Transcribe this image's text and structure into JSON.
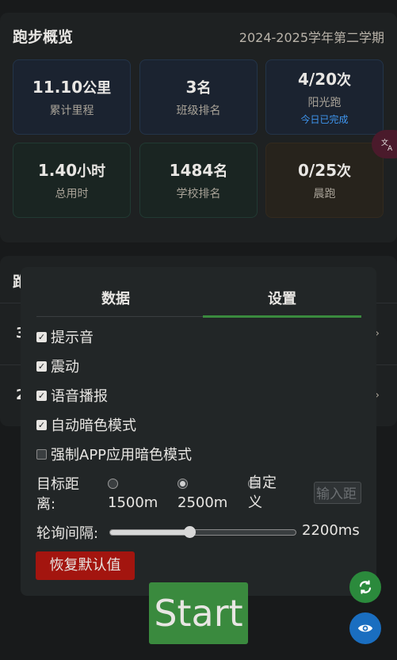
{
  "overview": {
    "title": "跑步概览",
    "term": "2024-2025学年第二学期",
    "stats": [
      {
        "value": "11.10",
        "unit": "公里",
        "label": "累计里程"
      },
      {
        "value": "3",
        "unit": "名",
        "label": "班级排名"
      },
      {
        "value": "4/20",
        "unit": "次",
        "label": "阳光跑",
        "sub": "今日已完成"
      },
      {
        "value": "1.40",
        "unit": "小时",
        "label": "总用时"
      },
      {
        "value": "1484",
        "unit": "名",
        "label": "学校排名"
      },
      {
        "value": "0/25",
        "unit": "次",
        "label": "晨跑"
      }
    ],
    "translate_icon": "translate-icon"
  },
  "background_list": {
    "heading_fragment": "跑",
    "row_numbers": [
      "3",
      "2"
    ]
  },
  "settings_panel": {
    "tabs": [
      {
        "label": "数据",
        "active": false
      },
      {
        "label": "设置",
        "active": true
      }
    ],
    "options": [
      {
        "label": "提示音",
        "checked": true
      },
      {
        "label": "震动",
        "checked": true
      },
      {
        "label": "语音播报",
        "checked": true
      },
      {
        "label": "自动暗色模式",
        "checked": true
      },
      {
        "label": "强制APP应用暗色模式",
        "checked": false
      }
    ],
    "target_distance": {
      "label": "目标距离:",
      "choices": [
        {
          "label": "1500m",
          "selected": false
        },
        {
          "label": "2500m",
          "selected": true
        },
        {
          "label": "自定义",
          "selected": false
        }
      ],
      "input_placeholder": "输入距"
    },
    "poll_interval": {
      "label": "轮询间隔:",
      "value_text": "2200ms",
      "slider_fraction": 0.43
    },
    "reset_label": "恢复默认值"
  },
  "start_label": "Start",
  "fabs": {
    "refresh_icon": "refresh-icon",
    "eye_icon": "eye-icon"
  },
  "colors": {
    "accent_green": "#3a8a3e",
    "reset_red": "#a3150f",
    "link_blue": "#3f96f0"
  }
}
